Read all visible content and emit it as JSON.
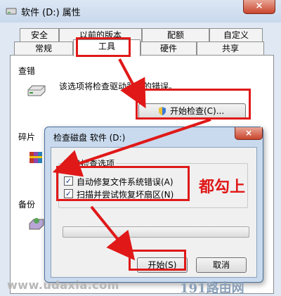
{
  "window": {
    "title": "软件 (D:) 属性",
    "close_label": "×"
  },
  "tabs_row1": [
    "安全",
    "以前的版本",
    "配额",
    "自定义"
  ],
  "tabs_row2": [
    "常规",
    "工具",
    "硬件",
    "共享"
  ],
  "active_tab": "工具",
  "error_check": {
    "caption": "查错",
    "text": "该选项将检查驱动器中的错误。",
    "button": "开始检查(C)..."
  },
  "defrag": {
    "caption": "碎片"
  },
  "backup": {
    "caption": "备份"
  },
  "dialog": {
    "title": "检查磁盘 软件 (D:)",
    "close_label": "×",
    "options_caption": "磁盘检查选项",
    "options": [
      {
        "label": "自动修复文件系统错误(A)",
        "checked": true
      },
      {
        "label": "扫描并尝试恢复坏扇区(N)",
        "checked": true
      }
    ],
    "progress": 0,
    "start_button": "开始(S)",
    "cancel_button": "取消"
  },
  "annotation": "都勾上",
  "watermarks": {
    "left": "www.udaxia.com",
    "right": "191路由网"
  },
  "colors": {
    "highlight": "#e01818",
    "accent": "#4a6e99"
  }
}
